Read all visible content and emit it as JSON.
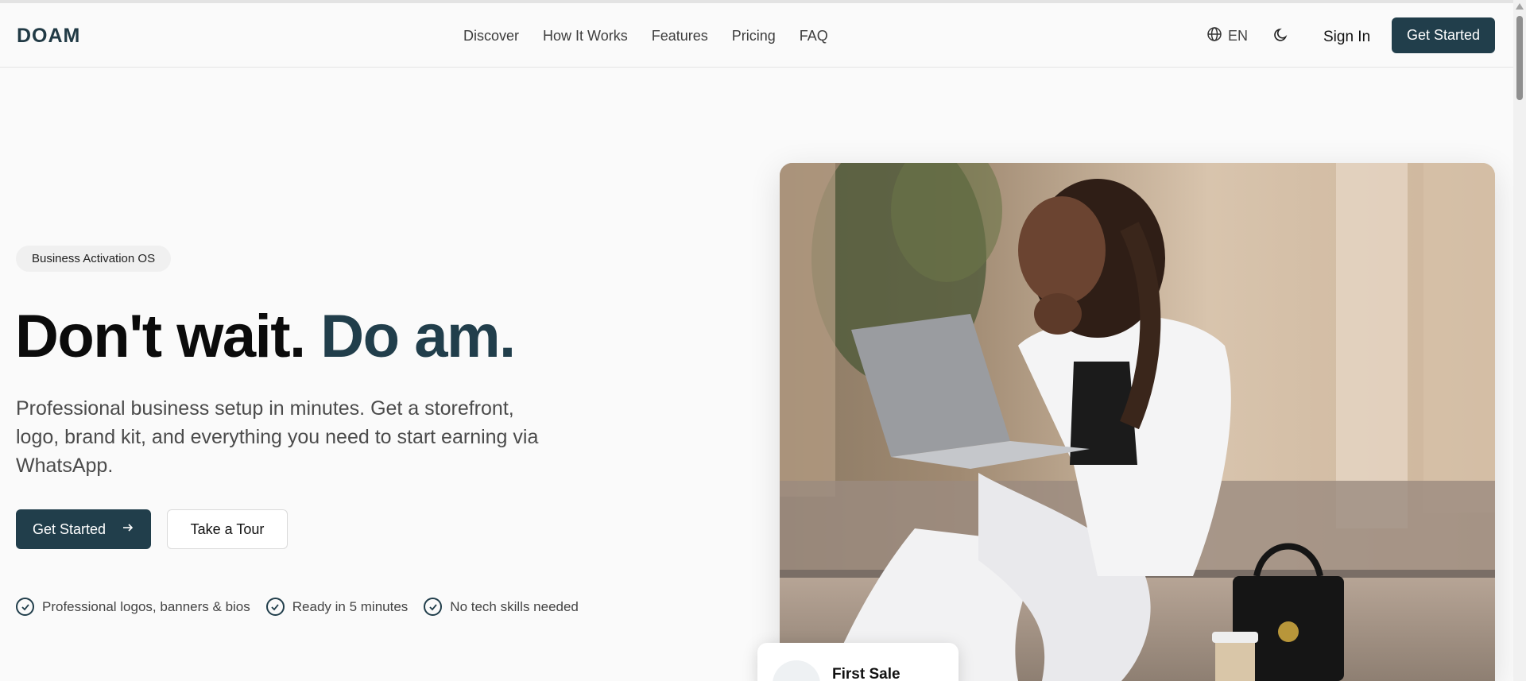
{
  "header": {
    "logo": "DOAM",
    "nav": [
      "Discover",
      "How It Works",
      "Features",
      "Pricing",
      "FAQ"
    ],
    "language": "EN",
    "sign_in": "Sign In",
    "cta": "Get Started"
  },
  "hero": {
    "badge": "Business Activation OS",
    "headline_main": "Don't wait.",
    "headline_accent": "Do am.",
    "subtitle": "Professional business setup in minutes. Get a storefront, logo, brand kit, and everything you need to start earning via WhatsApp.",
    "primary_cta": "Get Started",
    "secondary_cta": "Take a Tour",
    "features": [
      "Professional logos, banners & bios",
      "Ready in 5 minutes",
      "No tech skills needed"
    ]
  },
  "floating_card": {
    "title": "First Sale"
  },
  "colors": {
    "brand": "#213e4b",
    "background": "#fafafa"
  },
  "icons": {
    "language": "globe-icon",
    "theme": "moon-icon",
    "cta_arrow": "arrow-right-icon",
    "feature_check": "check-circle-icon"
  }
}
